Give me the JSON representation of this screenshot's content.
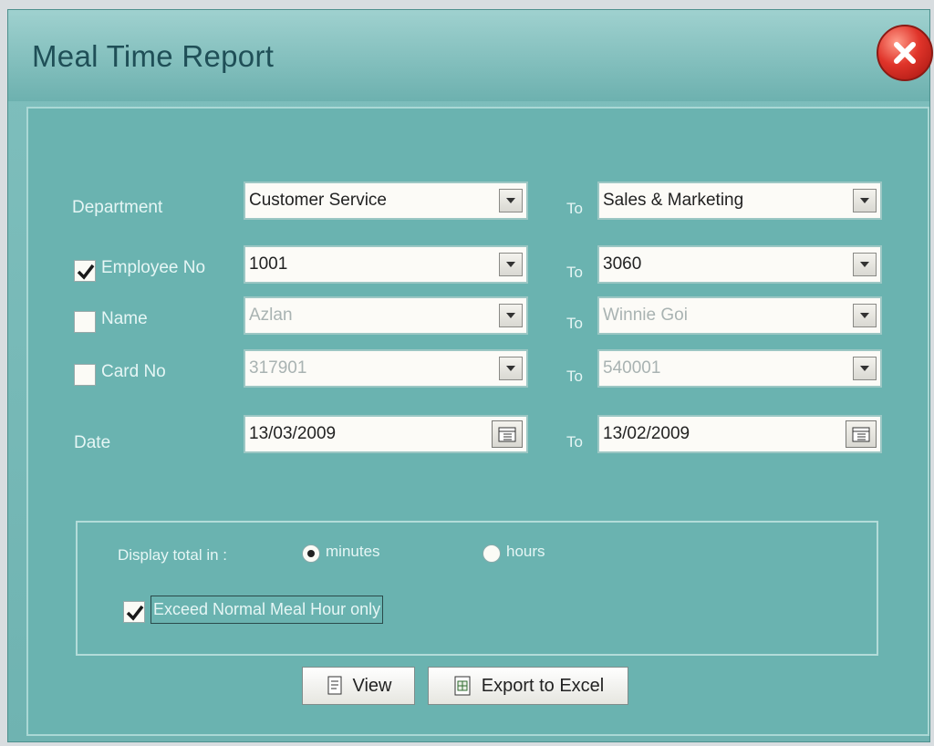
{
  "window": {
    "title": "Meal Time Report"
  },
  "filters": {
    "department": {
      "label": "Department",
      "from": "Customer Service",
      "to_label": "To",
      "to": "Sales & Marketing"
    },
    "employee_no": {
      "label": "Employee No",
      "checked": true,
      "from": "1001",
      "to_label": "To",
      "to": "3060"
    },
    "name": {
      "label": "Name",
      "checked": false,
      "from": "Azlan",
      "to_label": "To",
      "to": "Winnie Goi"
    },
    "card_no": {
      "label": "Card No",
      "checked": false,
      "from": "317901",
      "to_label": "To",
      "to": "540001"
    },
    "date": {
      "label": "Date",
      "from": "13/03/2009",
      "to_label": "To",
      "to": "13/02/2009"
    }
  },
  "options": {
    "display_label": "Display total in :",
    "minutes_label": "minutes",
    "hours_label": "hours",
    "selected": "minutes",
    "exceed_label": "Exceed Normal Meal Hour only",
    "exceed_checked": true
  },
  "buttons": {
    "view": "View",
    "export": "Export to Excel"
  }
}
